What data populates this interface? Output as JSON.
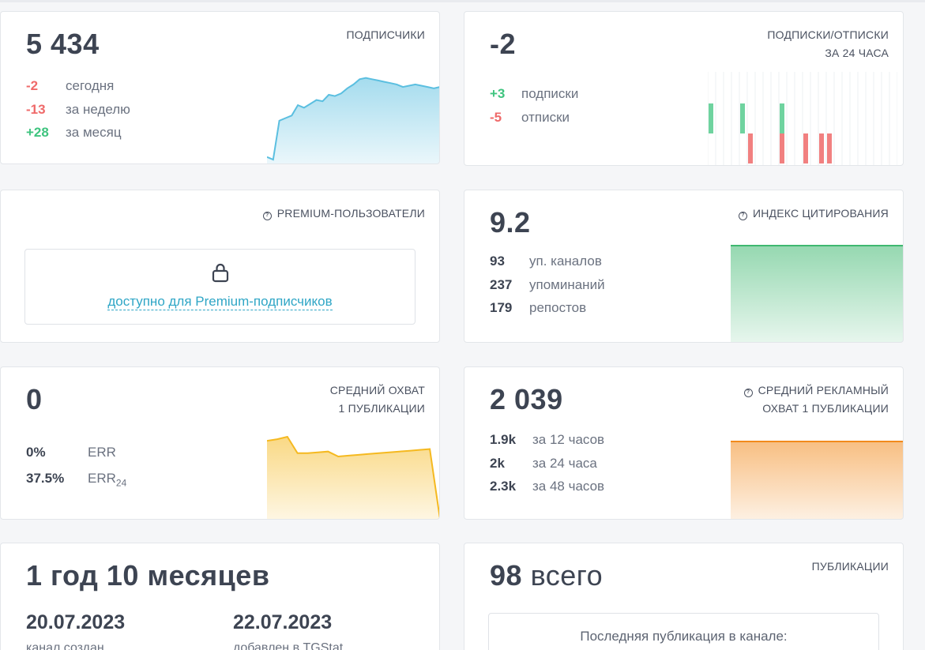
{
  "subscribers": {
    "value": "5 434",
    "label": "ПОДПИСЧИКИ",
    "stats": [
      {
        "value": "-2",
        "text": "сегодня",
        "tone": "neg"
      },
      {
        "value": "-13",
        "text": "за неделю",
        "tone": "neg"
      },
      {
        "value": "+28",
        "text": "за месяц",
        "tone": "pos"
      }
    ]
  },
  "subs_unsubs": {
    "value": "-2",
    "label_line1": "ПОДПИСКИ/ОТПИСКИ",
    "label_line2": "ЗА 24 ЧАСА",
    "stats": [
      {
        "value": "+3",
        "text": "подписки",
        "tone": "pos"
      },
      {
        "value": "-5",
        "text": "отписки",
        "tone": "neg"
      }
    ]
  },
  "premium": {
    "label": "PREMIUM-ПОЛЬЗОВАТЕЛИ",
    "locked_text": "доступно для Premium-подписчиков"
  },
  "citation": {
    "value": "9.2",
    "label": "ИНДЕКС ЦИТИРОВАНИЯ",
    "stats": [
      {
        "value": "93",
        "text": "уп. каналов"
      },
      {
        "value": "237",
        "text": "упоминаний"
      },
      {
        "value": "179",
        "text": "репостов"
      }
    ]
  },
  "avg_reach": {
    "value": "0",
    "label_line1": "СРЕДНИЙ ОХВАТ",
    "label_line2": "1 ПУБЛИКАЦИИ",
    "err_value": "0%",
    "err_label": "ERR",
    "err24_value": "37.5%",
    "err24_label": "ERR",
    "err24_sub": "24"
  },
  "ad_reach": {
    "value": "2 039",
    "label_line1": "СРЕДНИЙ РЕКЛАМНЫЙ",
    "label_line2": "ОХВАТ 1 ПУБЛИКАЦИИ",
    "stats": [
      {
        "value": "1.9k",
        "text": "за 12 часов"
      },
      {
        "value": "2k",
        "text": "за 24 часа"
      },
      {
        "value": "2.3k",
        "text": "за 48 часов"
      }
    ]
  },
  "age": {
    "value": "1 год 10 месяцев",
    "created_date": "20.07.2023",
    "created_label": "канал создан",
    "added_date": "22.07.2023",
    "added_label": "добавлен в TGStat"
  },
  "publications": {
    "value": "98",
    "value_suffix": "всего",
    "label": "ПУБЛИКАЦИИ",
    "last_pub_text": "Последняя публикация в канале:"
  },
  "colors": {
    "negative": "#ef6a6a",
    "positive": "#3fc47f",
    "subs_chart": "#5bbfe0",
    "citation_chart": "#3fb870",
    "reach_chart": "#f5b920",
    "ad_chart": "#f28a1c",
    "link": "#2fa6c6"
  },
  "chart_data": [
    {
      "type": "area",
      "title": "ПОДПИСЧИКИ",
      "series": [
        {
          "values": [
            5380,
            5378,
            5408,
            5410,
            5412,
            5420,
            5418,
            5421,
            5424,
            5423,
            5428,
            5427,
            5429,
            5433,
            5436,
            5440,
            5441,
            5440,
            5439,
            5438,
            5437,
            5436,
            5434,
            5435,
            5436,
            5435,
            5434,
            5433,
            5434
          ]
        }
      ]
    },
    {
      "type": "bar",
      "title": "ПОДПИСКИ/ОТПИСКИ ЗА 24 ЧАСА",
      "series": [
        {
          "values": [
            1,
            0,
            0,
            0,
            1,
            0,
            0,
            0,
            0,
            1,
            0,
            0,
            0,
            0,
            0,
            0,
            0,
            0,
            0,
            0,
            0,
            0,
            0,
            0
          ]
        },
        {
          "values": [
            0,
            0,
            0,
            0,
            0,
            -1,
            0,
            0,
            0,
            -1,
            0,
            0,
            -1,
            0,
            -1,
            -1,
            0,
            0,
            0,
            0,
            0,
            0,
            0,
            0
          ]
        }
      ]
    },
    {
      "type": "area",
      "title": "ИНДЕКС ЦИТИРОВАНИЯ",
      "series": [
        {
          "values": [
            9.2,
            9.2,
            9.2,
            9.2,
            9.2,
            9.2,
            9.2,
            9.2
          ]
        }
      ]
    },
    {
      "type": "area",
      "title": "СРЕДНИЙ ОХВАТ 1 ПУБЛИКАЦИИ",
      "series": [
        {
          "values": [
            0.95,
            0.97,
            1.0,
            0.8,
            0.8,
            0.81,
            0.82,
            0.76,
            0.77,
            0.78,
            0.79,
            0.8,
            0.81,
            0.82,
            0.83,
            0.84,
            0.85,
            0.0
          ]
        }
      ]
    },
    {
      "type": "area",
      "title": "СРЕДНИЙ РЕКЛАМНЫЙ ОХВАТ 1 ПУБЛИКАЦИИ",
      "series": [
        {
          "values": [
            2039,
            2039,
            2039,
            2039,
            2039,
            2039,
            2039,
            2039
          ]
        }
      ]
    }
  ]
}
